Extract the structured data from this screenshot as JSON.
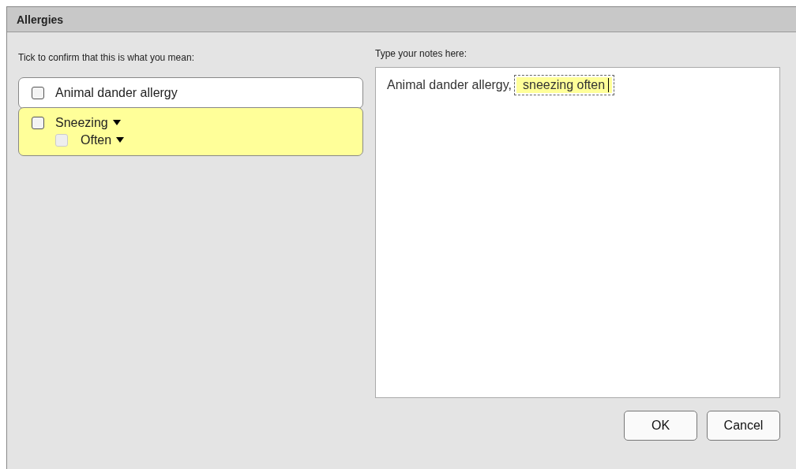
{
  "window": {
    "title": "Allergies"
  },
  "left": {
    "label": "Tick to confirm that this is what you mean:",
    "options": [
      {
        "label": "Animal dander allergy",
        "checked": false,
        "highlighted": false,
        "dropdown": false
      },
      {
        "label": "Sneezing",
        "checked": false,
        "highlighted": true,
        "dropdown": true,
        "children": [
          {
            "label": "Often",
            "checked": false,
            "disabled": true,
            "dropdown": true
          }
        ]
      }
    ]
  },
  "notes": {
    "label": "Type your notes here:",
    "segments": [
      {
        "text": "Animal dander allergy,",
        "highlighted": false
      },
      {
        "text": "sneezing often",
        "highlighted": true
      }
    ]
  },
  "buttons": [
    {
      "label": "OK"
    },
    {
      "label": "Cancel"
    }
  ]
}
